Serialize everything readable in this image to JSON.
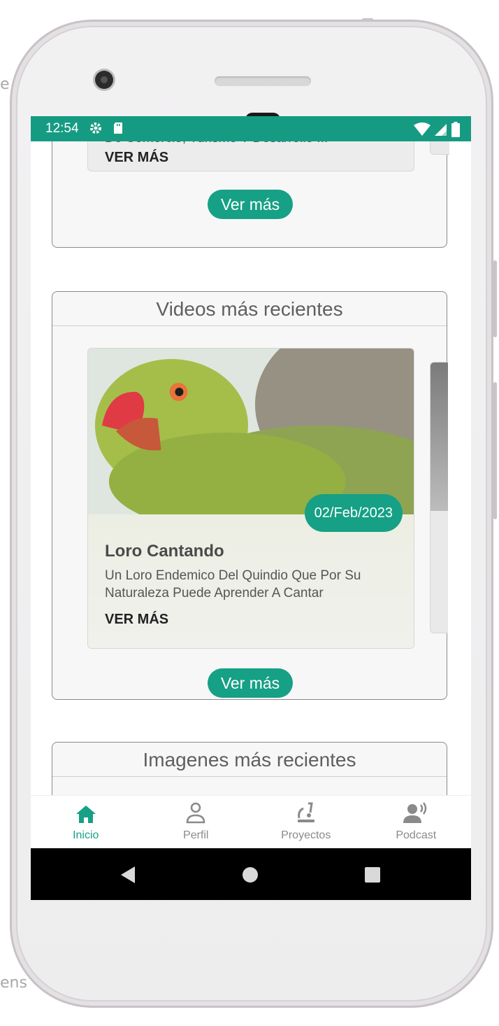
{
  "stray_text": {
    "top_edge": "e",
    "bottom_edge": "ens"
  },
  "status_bar": {
    "time": "12:54",
    "icons": [
      "gear-icon",
      "sd-card-icon"
    ],
    "right_icons": [
      "wifi-icon",
      "signal-icon",
      "battery-icon"
    ],
    "color": "#169b83"
  },
  "sections": {
    "articles": {
      "card": {
        "description": "El Paisaje Cafetero Y Su Influencia En Las Redes De Comercio, Turismo Y Desarrollo ...",
        "link": "VER MÁS"
      },
      "more_button": "Ver más"
    },
    "videos": {
      "title": "Videos más recientes",
      "card": {
        "date": "02/Feb/2023",
        "title": "Loro Cantando",
        "description": "Un Loro Endemico Del Quindio Que Por Su Naturaleza Puede Aprender A Cantar",
        "link": "VER MÁS"
      },
      "more_button": "Ver más"
    },
    "images": {
      "title": "Imagenes más recientes"
    }
  },
  "bottom_nav": {
    "items": [
      {
        "label": "Inicio",
        "icon": "home-icon",
        "active": true
      },
      {
        "label": "Perfil",
        "icon": "person-icon",
        "active": false
      },
      {
        "label": "Proyectos",
        "icon": "microscope-icon",
        "active": false
      },
      {
        "label": "Podcast",
        "icon": "podcast-speaker-icon",
        "active": false
      }
    ]
  },
  "system_nav": [
    "back-icon",
    "home-circle-icon",
    "recents-icon"
  ],
  "colors": {
    "accent": "#16a085",
    "nav_inactive": "#8a8a8a"
  }
}
